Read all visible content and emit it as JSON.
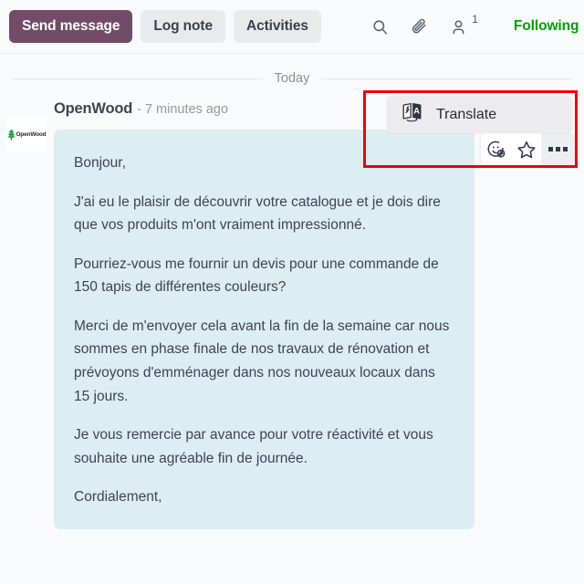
{
  "topbar": {
    "send_message_label": "Send message",
    "log_note_label": "Log note",
    "activities_label": "Activities",
    "search_icon": "search-icon",
    "attachment_icon": "paperclip-icon",
    "followers_icon": "user-icon",
    "follower_count": "1",
    "following_label": "Following",
    "following_color": "#00a000",
    "primary_color": "#714b67"
  },
  "date_separator": {
    "label": "Today"
  },
  "message": {
    "author": "OpenWood",
    "timestamp": "- 7 minutes ago",
    "avatar_wordmark": "OpenWood",
    "bubble_color": "#dceef2",
    "paragraphs": [
      "Bonjour,",
      "J'ai eu le plaisir de découvrir votre catalogue et je dois dire que vos produits m'ont vraiment impressionné.",
      "Pourriez-vous me fournir un devis pour une commande de 150 tapis de différentes couleurs?",
      "Merci de m'envoyer cela avant la fin de la semaine car nous sommes en phase finale de nos travaux de rénovation et prévoyons d'emménager dans nos nouveaux locaux dans 15 jours.",
      "Je vous remercie par avance pour votre réactivité et vous souhaite une agréable fin de journée.",
      "Cordialement,"
    ]
  },
  "message_actions": {
    "add_reaction_icon": "add-reaction-icon",
    "mark_todo_icon": "star-icon",
    "expand_icon": "ellipsis-icon"
  },
  "translate_tooltip": {
    "label": "Translate",
    "icon": "translate-icon"
  },
  "highlight": {
    "color": "#ef0000"
  }
}
